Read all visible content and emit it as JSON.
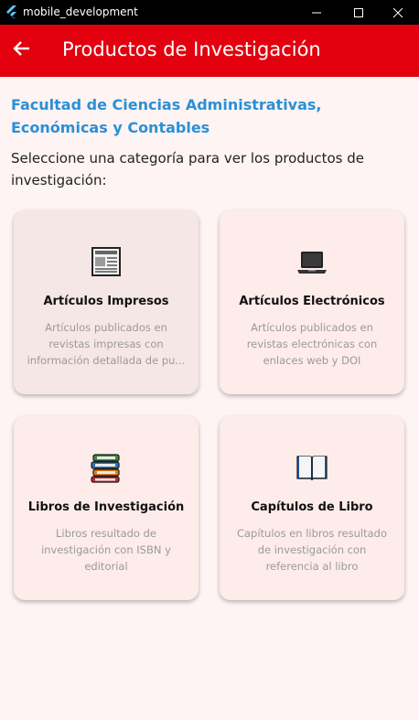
{
  "window": {
    "title": "mobile_development",
    "controls": {
      "minimize": "—",
      "maximize": "☐",
      "close": "✕"
    }
  },
  "appbar": {
    "back_icon": "arrow-left-icon",
    "title": "Productos de Investigación"
  },
  "faculty": "Facultad de Ciencias Administrativas, Económicas y Contables",
  "instructions": "Seleccione una categoría para ver los productos de investigación:",
  "categories": [
    {
      "title": "Artículos Impresos",
      "icon": "newspaper-icon",
      "description_lines": [
        "Artículos publicados en",
        "revistas impresas con",
        "información detallada de pu..."
      ]
    },
    {
      "title": "Artículos Electrónicos",
      "icon": "laptop-icon",
      "description_lines": [
        "Artículos publicados en",
        "revistas electrónicas con",
        "enlaces web y DOI"
      ]
    },
    {
      "title": "Libros de Investigación",
      "icon": "books-icon",
      "description_lines": [
        "Libros resultado de",
        "investigación con ISBN y",
        "editorial"
      ]
    },
    {
      "title": "Capítulos de Libro",
      "icon": "open-book-icon",
      "description_lines": [
        "Capítulos en libros resultado",
        "de investigación con",
        "referencia al libro"
      ]
    }
  ],
  "colors": {
    "appbar": "#e3000f",
    "faculty_text": "#2b8fd6",
    "card_bg": "#fdecea",
    "page_bg": "#fdf4f3"
  }
}
